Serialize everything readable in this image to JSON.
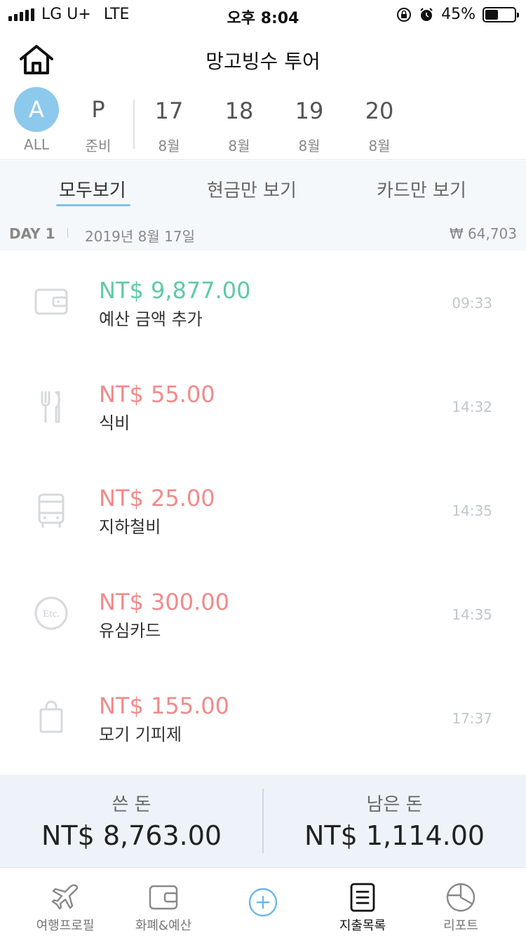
{
  "status_bar": {
    "carrier": "LG U+",
    "network": "LTE",
    "time": "오후 8:04",
    "battery_percent": "45%",
    "battery_level": 0.45
  },
  "header": {
    "title": "망고빙수 투어",
    "home_icon": "home-icon"
  },
  "days": {
    "all": {
      "letter": "A",
      "label": "ALL"
    },
    "prep": {
      "letter": "P",
      "label": "준비"
    },
    "list": [
      {
        "day": "17",
        "month": "8월"
      },
      {
        "day": "18",
        "month": "8월"
      },
      {
        "day": "19",
        "month": "8월"
      },
      {
        "day": "20",
        "month": "8월"
      }
    ]
  },
  "filters": {
    "all": "모두보기",
    "cash": "현금만 보기",
    "card": "카드만 보기"
  },
  "day_header": {
    "label": "DAY 1",
    "date": "2019년 8월 17일",
    "total": "₩ 64,703"
  },
  "transactions": [
    {
      "amount": "NT$ 9,877.00",
      "label": "예산 금액 추가",
      "time": "09:33",
      "type": "income",
      "icon": "wallet-icon"
    },
    {
      "amount": "NT$ 55.00",
      "label": "식비",
      "time": "14:32",
      "type": "expense",
      "icon": "fork-knife-icon"
    },
    {
      "amount": "NT$ 25.00",
      "label": "지하철비",
      "time": "14:35",
      "type": "expense",
      "icon": "bus-icon"
    },
    {
      "amount": "NT$ 300.00",
      "label": "유심카드",
      "time": "14:35",
      "type": "expense",
      "icon": "etc-icon"
    },
    {
      "amount": "NT$ 155.00",
      "label": "모기 기피제",
      "time": "17:37",
      "type": "expense",
      "icon": "shopping-bag-icon"
    }
  ],
  "summary": {
    "spent_label": "쓴 돈",
    "spent_value": "NT$ 8,763.00",
    "remaining_label": "남은 돈",
    "remaining_value": "NT$ 1,114.00"
  },
  "nav": {
    "profile": "여행프로필",
    "currency": "화폐&예산",
    "add": "",
    "list": "지출목록",
    "report": "리포트"
  },
  "colors": {
    "accent": "#8dc9ec",
    "income": "#5fcaa5",
    "expense": "#f28a8a"
  }
}
